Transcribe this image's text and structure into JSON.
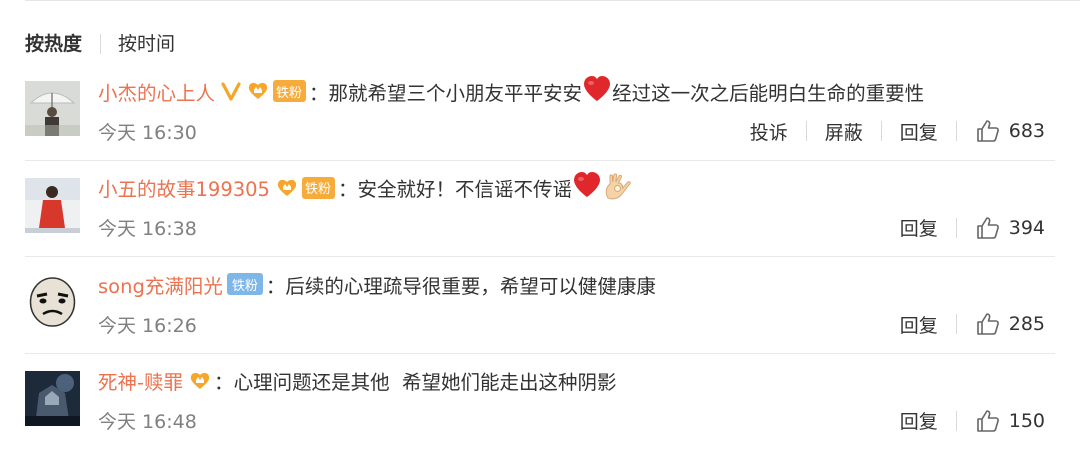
{
  "sort": {
    "hot_label": "按热度",
    "time_label": "按时间"
  },
  "colors": {
    "username": "#eb7350",
    "timestamp": "#808080",
    "fan_badge_gold": "#f6ab3a",
    "fan_badge_blue": "#7fb6e8",
    "heart": "#e0272c"
  },
  "comments": [
    {
      "user": "小杰的心上人",
      "verified_mark": "V",
      "fan_badge": "铁粉",
      "colon": "：",
      "text_parts": [
        "那就希望三个小朋友平平安安",
        "经过这一次之后能明白生命的重要性"
      ],
      "emoji": [
        "red-heart-emoji"
      ],
      "time": "今天 16:30",
      "actions": [
        "投诉",
        "屏蔽",
        "回复"
      ],
      "likes": "683"
    },
    {
      "user": "小五的故事199305",
      "fan_badge": "铁粉",
      "colon": "：",
      "text_parts": [
        "安全就好！不信谣不传谣"
      ],
      "emoji": [
        "red-heart-emoji",
        "ok-hand-emoji"
      ],
      "time": "今天 16:38",
      "actions": [
        "回复"
      ],
      "likes": "394"
    },
    {
      "user": "song充满阳光",
      "fan_badge": "铁粉",
      "colon": "：",
      "text_parts": [
        "后续的心理疏导很重要，希望可以健健康康"
      ],
      "time": "今天 16:26",
      "actions": [
        "回复"
      ],
      "likes": "285"
    },
    {
      "user": "死神-赎罪",
      "colon": "：",
      "text_parts": [
        "心理问题还是其他  希望她们能走出这种阴影"
      ],
      "time": "今天 16:48",
      "actions": [
        "回复"
      ],
      "likes": "150"
    }
  ]
}
